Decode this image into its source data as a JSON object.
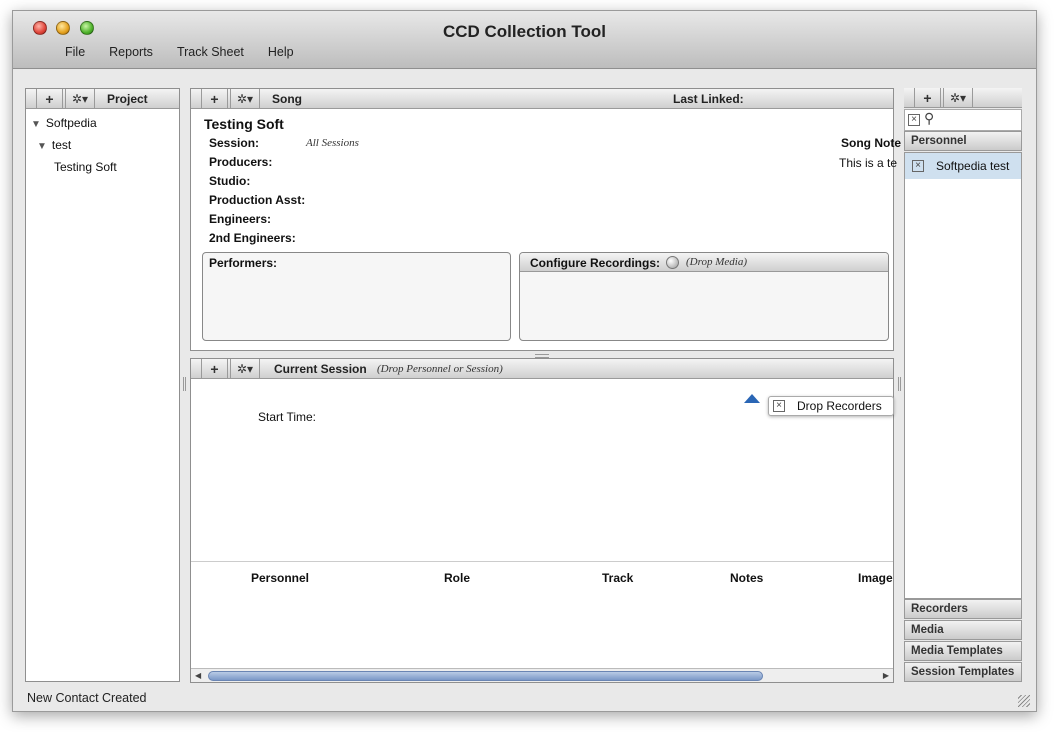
{
  "window": {
    "title": "CCD Collection Tool",
    "menus": [
      "File",
      "Reports",
      "Track Sheet",
      "Help"
    ]
  },
  "toolbar_symbols": {
    "add": "+",
    "gear": "✲▾"
  },
  "project_panel": {
    "header": "Project",
    "tree": [
      {
        "label": "Softpedia",
        "expanded": true
      },
      {
        "label": "test",
        "expanded": true
      },
      {
        "label": "Testing Soft"
      }
    ]
  },
  "song_panel": {
    "header": "Song",
    "last_linked_label": "Last Linked:",
    "song_title": "Testing Soft",
    "fields": {
      "session_label": "Session:",
      "session_value": "All Sessions",
      "producers_label": "Producers:",
      "studio_label": "Studio:",
      "production_asst_label": "Production Asst:",
      "engineers_label": "Engineers:",
      "second_engineers_label": "2nd Engineers:"
    },
    "song_notes_label": "Song Note",
    "song_notes_value": "This is a te",
    "performers_label": "Performers:",
    "configure_recordings_label": "Configure Recordings:",
    "drop_media_hint": "(Drop Media)"
  },
  "session_panel": {
    "header": "Current Session",
    "drop_hint": "(Drop Personnel or Session)",
    "start_time_label": "Start Time:",
    "drop_recorders": "Drop Recorders",
    "columns": [
      "Personnel",
      "Role",
      "Track",
      "Notes",
      "Image"
    ]
  },
  "right_panel": {
    "sections": [
      "Personnel",
      "Recorders",
      "Media",
      "Media Templates",
      "Session Templates"
    ],
    "personnel_items": [
      "Softpedia test"
    ]
  },
  "status": {
    "message": "New Contact Created"
  }
}
